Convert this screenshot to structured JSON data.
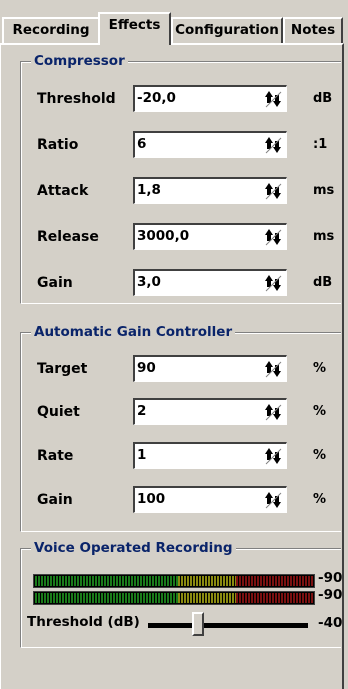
{
  "tabs": [
    {
      "label": "Recording",
      "active": false
    },
    {
      "label": "Effects",
      "active": true
    },
    {
      "label": "Configuration",
      "active": false
    },
    {
      "label": "Notes",
      "active": false
    }
  ],
  "compressor": {
    "title": "Compressor",
    "rows": [
      {
        "label": "Threshold",
        "value": "-20,0",
        "unit": "dB"
      },
      {
        "label": "Ratio",
        "value": "6",
        "unit": ":1"
      },
      {
        "label": "Attack",
        "value": "1,8",
        "unit": "ms"
      },
      {
        "label": "Release",
        "value": "3000,0",
        "unit": "ms"
      },
      {
        "label": "Gain",
        "value": "3,0",
        "unit": "dB"
      }
    ]
  },
  "agc": {
    "title": "Automatic Gain Controller",
    "rows": [
      {
        "label": "Target",
        "value": "90",
        "unit": "%"
      },
      {
        "label": "Quiet",
        "value": "2",
        "unit": "%"
      },
      {
        "label": "Rate",
        "value": "1",
        "unit": "%"
      },
      {
        "label": "Gain",
        "value": "100",
        "unit": "%"
      }
    ]
  },
  "vor": {
    "title": "Voice Operated Recording",
    "meter_left_value": "-90",
    "meter_right_value": "-90",
    "threshold_label": "Threshold (dB)",
    "threshold_value": "-40",
    "threshold_slider_fraction": 0.31
  },
  "colors": {
    "meter_green": "#1a7a1a",
    "meter_yellow": "#8a8a10",
    "meter_red": "#7a1010",
    "group_title": "#0a246a"
  },
  "icons": {
    "spin": "up-down-spin-icon"
  }
}
